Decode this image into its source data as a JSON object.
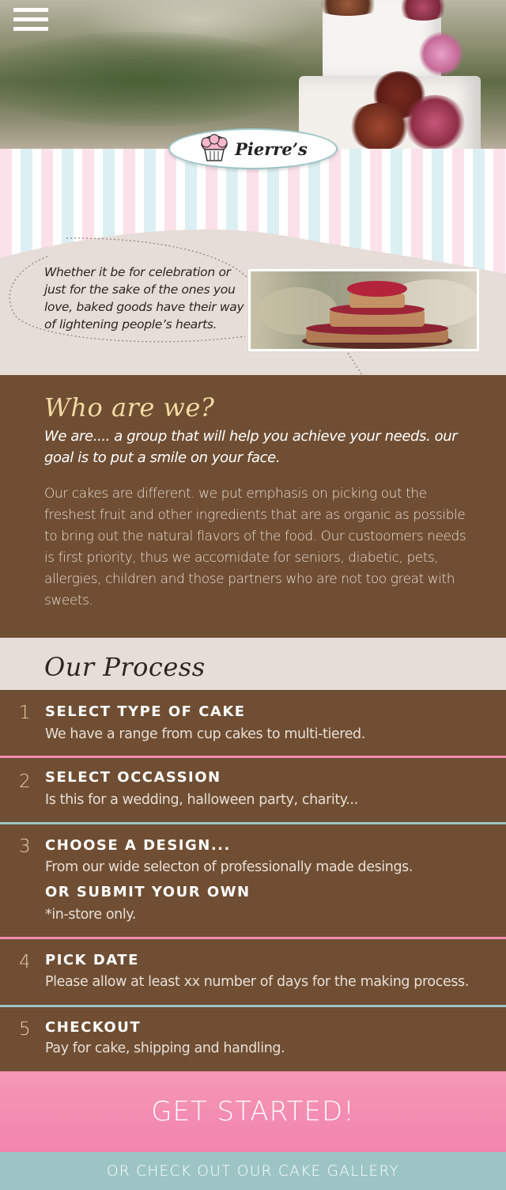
{
  "brand": {
    "name": "Pierre’s"
  },
  "hero": {
    "menu_icon": "hamburger-menu-icon"
  },
  "intro": {
    "quote": "Whether it be for celebration or just for the sake of the ones you love, baked goods have their way of lightening people’s hearts."
  },
  "who": {
    "title": "Who are we?",
    "lead": "We are.... a group that will help you achieve your needs. our goal is to put a smile on your face.",
    "body": "Our cakes are different. we put emphasis on picking out the freshest fruit and other ingredients that are as organic as possible to bring out the natural flavors of the food. Our custoomers needs is first priority, thus we accomidate for seniors, diabetic, pets, allergies, children and those partners who are not too great with sweets."
  },
  "process": {
    "title": "Our Process",
    "steps": [
      {
        "num": "1",
        "title": "SELECT TYPE OF CAKE",
        "desc": "We have a range from cup cakes to multi-tiered."
      },
      {
        "num": "2",
        "title": "SELECT OCCASSION",
        "desc": "Is this for a wedding, halloween party, charity..."
      },
      {
        "num": "3",
        "title": "CHOOSE A DESIGN...",
        "desc": "From our wide selecton of professionally made desings.",
        "title2": "OR SUBMIT YOUR OWN",
        "desc2": "*in-store only."
      },
      {
        "num": "4",
        "title": "PICK DATE",
        "desc": "Please allow at least xx number of days for the making process."
      },
      {
        "num": "5",
        "title": "CHECKOUT",
        "desc": "Pay for cake, shipping and handling."
      }
    ]
  },
  "cta": {
    "primary": "GET STARTED!",
    "secondary": "OR CHECK OUT OUR CAKE GALLERY"
  },
  "colors": {
    "brown": "#6f4e33",
    "pink": "#f38cb0",
    "teal": "#9cc4c4",
    "cream": "#e6dcd8",
    "gold": "#f3dba3"
  }
}
